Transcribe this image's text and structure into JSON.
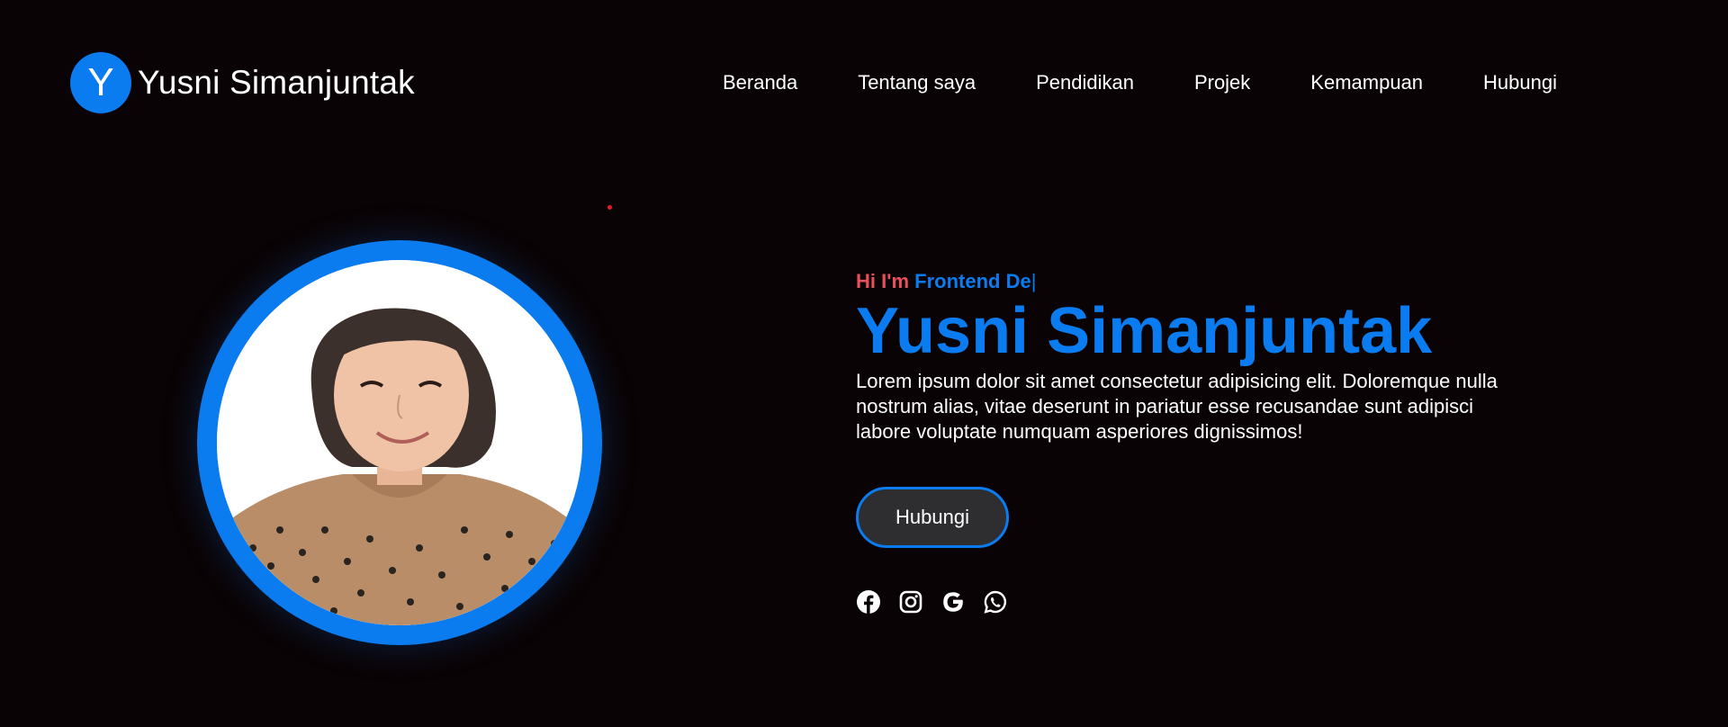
{
  "header": {
    "logo_letter": "Y",
    "logo_text": "Yusni Simanjuntak",
    "nav": [
      "Beranda",
      "Tentang saya",
      "Pendidikan",
      "Projek",
      "Kemampuan",
      "Hubungi"
    ]
  },
  "hero": {
    "greeting_prefix": "Hi I'm",
    "typed_role": "Frontend De",
    "caret": "|",
    "name": "Yusni Simanjuntak",
    "description": "Lorem ipsum dolor sit amet consectetur adipisicing elit. Doloremque nulla nostrum alias, vitae deserunt in pariatur esse recusandae sunt adipisci labore voluptate numquam asperiores dignissimos!",
    "cta_label": "Hubungi",
    "socials": [
      "facebook-icon",
      "instagram-icon",
      "google-icon",
      "whatsapp-icon"
    ]
  },
  "colors": {
    "background": "#0a0305",
    "accent": "#0a7cf0",
    "greeting": "#e8505b",
    "button_bg": "#2e2e30"
  }
}
